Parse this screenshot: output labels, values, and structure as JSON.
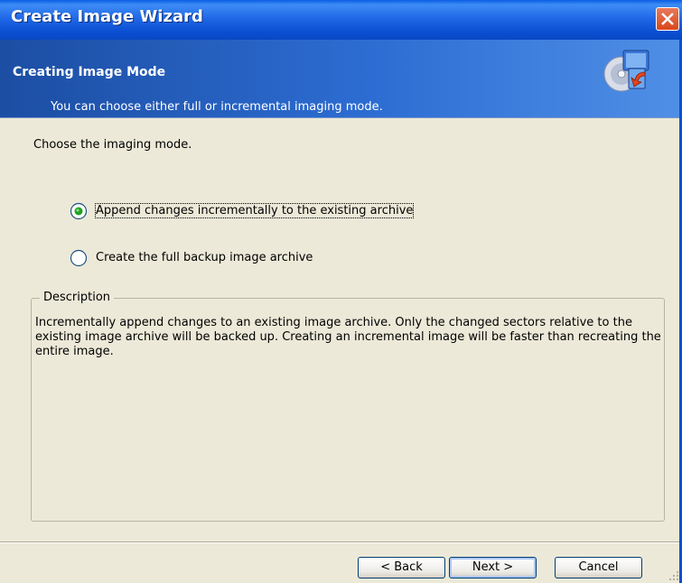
{
  "window": {
    "title": "Create Image Wizard"
  },
  "header": {
    "title": "Creating Image Mode",
    "subtitle": "You can choose either full or incremental imaging mode.",
    "icon": "disk-restore-icon"
  },
  "main": {
    "prompt": "Choose the imaging mode.",
    "options": [
      {
        "label": "Append changes incrementally to the existing archive",
        "selected": true
      },
      {
        "label": "Create the full backup image archive",
        "selected": false
      }
    ],
    "description": {
      "legend": "Description",
      "text": "Incrementally append changes to an existing image archive. Only the changed sectors relative to the existing image archive will be backed up. Creating an incremental image will be faster than recreating the entire image."
    }
  },
  "buttons": {
    "back": "< Back",
    "next": "Next >",
    "cancel": "Cancel"
  },
  "colors": {
    "title_bar": "#0a4fd1",
    "header": "#2d6dd3",
    "background": "#ece9d8",
    "radio_selected": "#21a121"
  }
}
